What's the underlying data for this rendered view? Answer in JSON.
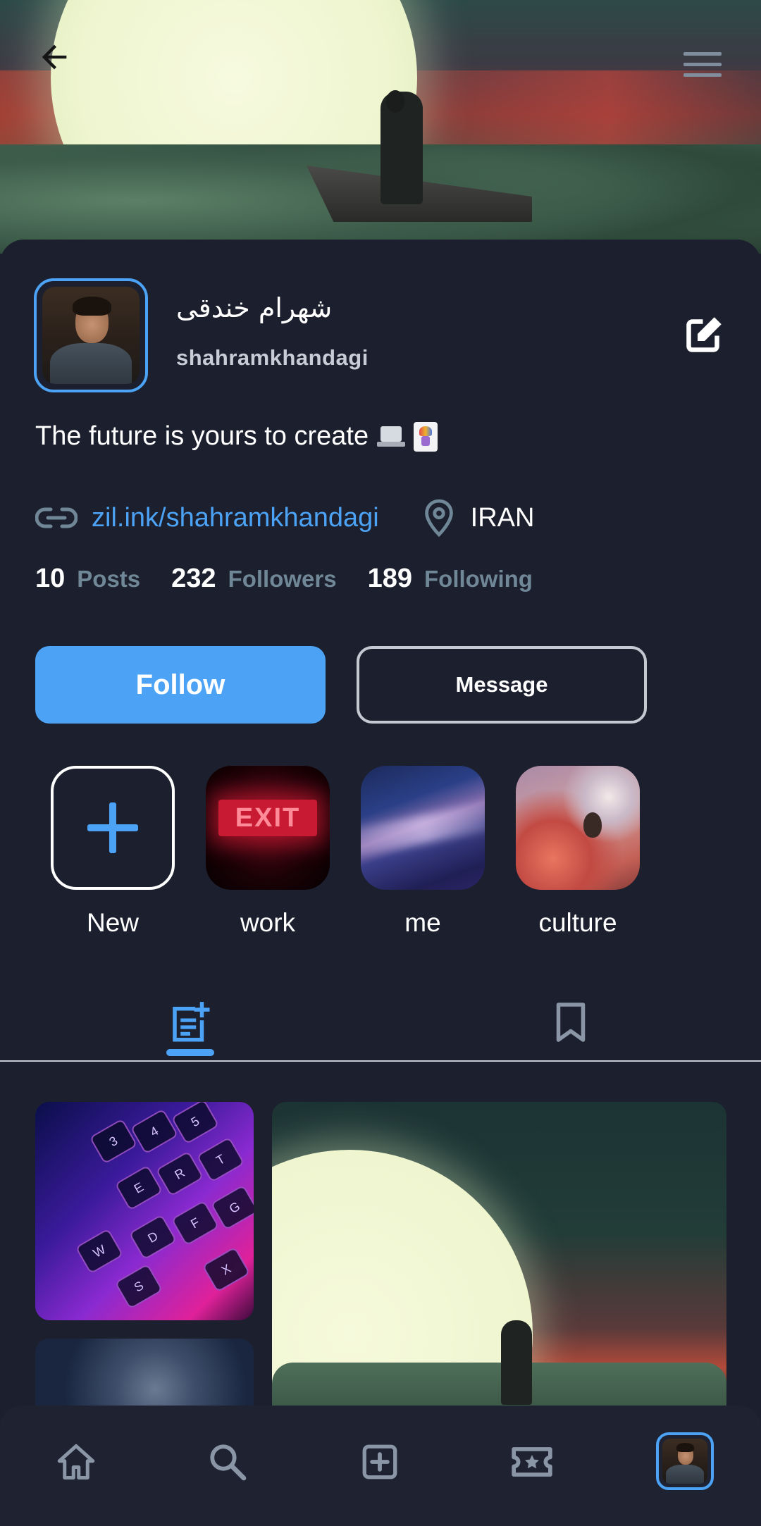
{
  "header": {
    "back_icon": "arrow-left-icon",
    "menu_icon": "hamburger-menu-icon"
  },
  "profile": {
    "display_name": "شهرام خندقی",
    "username": "shahramkhandagi",
    "bio": "The future is yours to create",
    "bio_emojis": [
      "laptop-emoji",
      "joker-card-emoji"
    ],
    "link": "zil.ink/shahramkhandagi",
    "location": "IRAN",
    "edit_icon": "edit-icon"
  },
  "stats": [
    {
      "value": "10",
      "label": "Posts"
    },
    {
      "value": "232",
      "label": "Followers"
    },
    {
      "value": "189",
      "label": "Following"
    }
  ],
  "actions": {
    "follow_label": "Follow",
    "message_label": "Message"
  },
  "highlights": [
    {
      "label": "New",
      "icon": "plus-icon"
    },
    {
      "label": "work",
      "sign_text": "EXIT"
    },
    {
      "label": "me"
    },
    {
      "label": "culture"
    }
  ],
  "tabs": [
    {
      "name": "posts",
      "icon": "post-add-icon",
      "active": true
    },
    {
      "name": "saved",
      "icon": "bookmark-icon",
      "active": false
    }
  ],
  "keyboard_keys": [
    "3",
    "4",
    "5",
    "E",
    "R",
    "T",
    "D",
    "F",
    "G",
    "W",
    "S",
    "X"
  ],
  "bottom_nav": [
    {
      "name": "home",
      "icon": "home-icon"
    },
    {
      "name": "search",
      "icon": "search-icon"
    },
    {
      "name": "create",
      "icon": "add-box-icon"
    },
    {
      "name": "reels",
      "icon": "ticket-star-icon"
    },
    {
      "name": "profile",
      "icon": "avatar",
      "active": true
    }
  ],
  "colors": {
    "accent": "#4ca3f5",
    "background": "#1c1f2d",
    "muted_label": "#6f8796",
    "nav_background": "#1e2231",
    "icon_gray": "#8a96a6"
  }
}
